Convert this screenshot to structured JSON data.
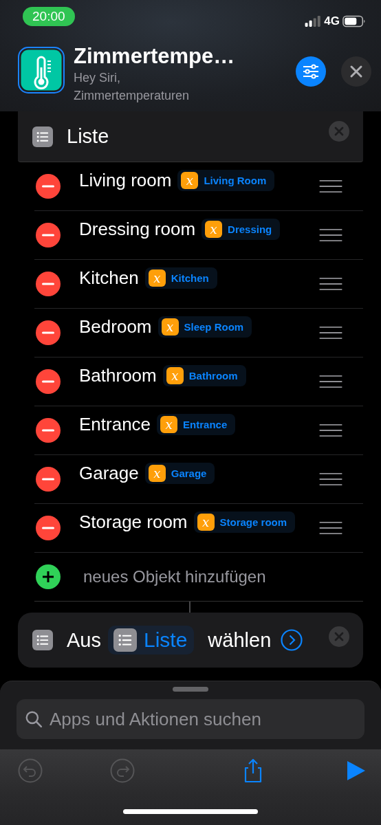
{
  "status_bar": {
    "time": "20:00",
    "network": "4G"
  },
  "header": {
    "title": "Zimmertempe…",
    "subtitle": "Hey Siri, Zimmertemperaturen"
  },
  "actions": [
    {
      "kind": "list",
      "title": "Liste",
      "add_label": "neues Objekt hinzufügen",
      "items": [
        {
          "label": "Living room",
          "variable": {
            "icon": "x",
            "name": "Living Room"
          }
        },
        {
          "label": "Dressing room",
          "variable": {
            "icon": "x",
            "name": "Dressing"
          }
        },
        {
          "label": "Kitchen",
          "variable": {
            "icon": "x",
            "name": "Kitchen"
          }
        },
        {
          "label": "Bedroom",
          "variable": {
            "icon": "x",
            "name": "Sleep Room"
          }
        },
        {
          "label": "Bathroom",
          "variable": {
            "icon": "x",
            "name": "Bathroom"
          }
        },
        {
          "label": "Entrance",
          "variable": {
            "icon": "x",
            "name": "Entrance"
          }
        },
        {
          "label": "Garage",
          "variable": {
            "icon": "x",
            "name": "Garage"
          }
        },
        {
          "label": "Storage room",
          "variable": {
            "icon": "x",
            "name": "Storage room"
          }
        }
      ]
    },
    {
      "kind": "choose",
      "before": "Aus",
      "variable": "Liste",
      "after": "wählen"
    }
  ],
  "search": {
    "placeholder": "Apps und Aktionen suchen"
  },
  "toolbar": [
    {
      "kind": "undo",
      "disabled": true
    },
    {
      "kind": "redo",
      "disabled": true
    },
    {
      "kind": "share",
      "disabled": false
    },
    {
      "kind": "play",
      "disabled": false
    }
  ]
}
